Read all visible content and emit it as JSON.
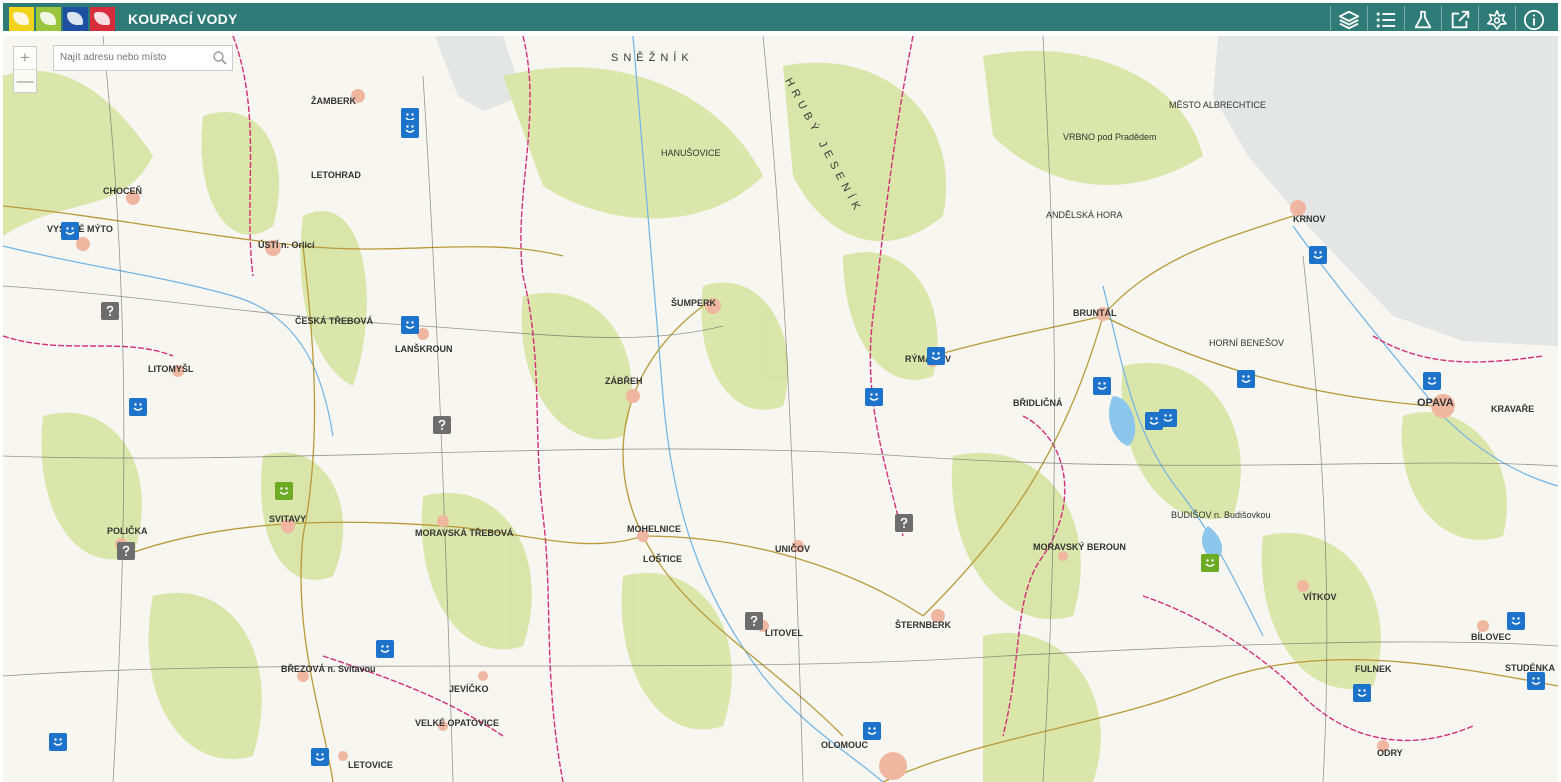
{
  "app": {
    "title": "KOUPACÍ VODY",
    "logos": [
      "logo-1",
      "logo-2",
      "logo-3",
      "logo-4"
    ]
  },
  "toolbar": {
    "buttons": [
      {
        "name": "layers-button",
        "icon": "layers-icon"
      },
      {
        "name": "legend-button",
        "icon": "list-icon"
      },
      {
        "name": "measurements-button",
        "icon": "flask-icon"
      },
      {
        "name": "open-external-button",
        "icon": "external-link-icon"
      },
      {
        "name": "settings-button",
        "icon": "star-gear-icon"
      },
      {
        "name": "info-button",
        "icon": "info-icon"
      }
    ]
  },
  "map": {
    "zoom_in": "+",
    "zoom_out": "—",
    "search_placeholder": "Najít adresu nebo místo",
    "places": [
      {
        "name": "ŽAMBERK"
      },
      {
        "name": "CHOCEŇ"
      },
      {
        "name": "VYSOKÉ MÝTO"
      },
      {
        "name": "ÚSTÍ n. Orlicí"
      },
      {
        "name": "LETOHRAD"
      },
      {
        "name": "ČESKÁ TŘEBOVÁ"
      },
      {
        "name": "LANŠKROUN"
      },
      {
        "name": "LITOMYŠL"
      },
      {
        "name": "SVITAVY"
      },
      {
        "name": "POLIČKA"
      },
      {
        "name": "MORAVSKÁ TŘEBOVÁ"
      },
      {
        "name": "ŠUMPERK"
      },
      {
        "name": "ZÁBŘEH"
      },
      {
        "name": "MOHELNICE"
      },
      {
        "name": "LOŠTICE"
      },
      {
        "name": "UNIČOV"
      },
      {
        "name": "LITOVEL"
      },
      {
        "name": "ŠTERNBERK"
      },
      {
        "name": "OLOMOUC"
      },
      {
        "name": "RÝMAŘOV"
      },
      {
        "name": "BRUNTÁL"
      },
      {
        "name": "KRNOV"
      },
      {
        "name": "OPAVA"
      },
      {
        "name": "KRAVAŘE"
      },
      {
        "name": "VÍTKOV"
      },
      {
        "name": "BÍLOVEC"
      },
      {
        "name": "ODRY"
      },
      {
        "name": "MORAVSKÝ BEROUN"
      },
      {
        "name": "BŘEZOVÁ n. Svitavou"
      },
      {
        "name": "JEVÍČKO"
      },
      {
        "name": "VELKÉ OPATOVICE"
      },
      {
        "name": "LETOVICE"
      },
      {
        "name": "HRUBÝ JESENÍK"
      },
      {
        "name": "SNĚŽNÍK"
      },
      {
        "name": "HANUŠOVICE"
      },
      {
        "name": "VRBNO pod Pradědem"
      },
      {
        "name": "MĚSTO ALBRECHTICE"
      },
      {
        "name": "ANDĚLSKÁ HORA"
      },
      {
        "name": "BUDIŠOV n. Budišovkou"
      },
      {
        "name": "FULNEK"
      },
      {
        "name": "HORNÍ BENEŠOV"
      },
      {
        "name": "BŘIDLIČNÁ"
      },
      {
        "name": "STUDÉNKA"
      }
    ],
    "markers": [
      {
        "status": "good"
      },
      {
        "status": "good"
      },
      {
        "status": "good"
      },
      {
        "status": "good"
      },
      {
        "status": "good"
      },
      {
        "status": "good"
      },
      {
        "status": "good"
      },
      {
        "status": "good"
      },
      {
        "status": "good"
      },
      {
        "status": "good"
      },
      {
        "status": "good"
      },
      {
        "status": "good"
      },
      {
        "status": "good"
      },
      {
        "status": "good"
      },
      {
        "status": "good"
      },
      {
        "status": "good"
      },
      {
        "status": "good"
      },
      {
        "status": "good"
      },
      {
        "status": "good"
      },
      {
        "status": "ok"
      },
      {
        "status": "ok"
      },
      {
        "status": "unknown"
      },
      {
        "status": "unknown"
      },
      {
        "status": "unknown"
      },
      {
        "status": "unknown"
      },
      {
        "status": "unknown"
      }
    ]
  },
  "colors": {
    "header": "#2e7b78",
    "marker_good": "#1d73c9",
    "marker_ok": "#6eab25",
    "marker_unknown": "#6d6d6d",
    "forest": "#d8e4a8",
    "border": "#d0307a"
  }
}
